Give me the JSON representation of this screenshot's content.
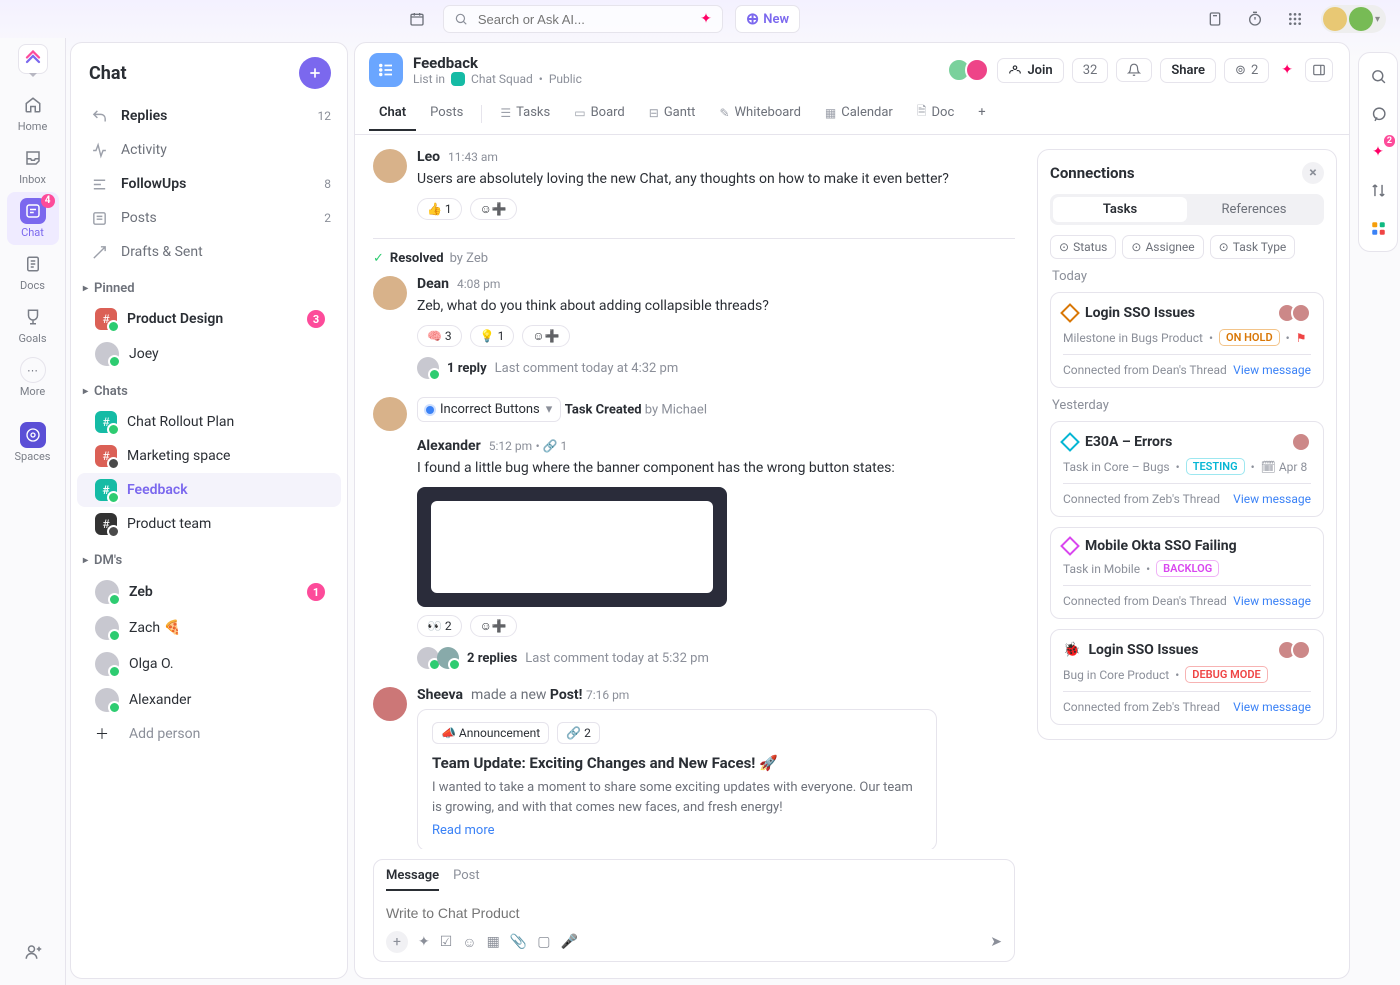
{
  "topbar": {
    "search_placeholder": "Search or Ask AI...",
    "new_label": "New"
  },
  "rail": [
    {
      "key": "home",
      "label": "Home"
    },
    {
      "key": "inbox",
      "label": "Inbox"
    },
    {
      "key": "chat",
      "label": "Chat",
      "active": true,
      "badge": "4"
    },
    {
      "key": "docs",
      "label": "Docs"
    },
    {
      "key": "goals",
      "label": "Goals"
    },
    {
      "key": "more",
      "label": "More"
    },
    {
      "key": "spaces",
      "label": "Spaces"
    }
  ],
  "sidebar": {
    "title": "Chat",
    "top": [
      {
        "label": "Replies",
        "count": "12",
        "bold": true,
        "icon": "reply-icon"
      },
      {
        "label": "Activity",
        "icon": "activity-icon"
      },
      {
        "label": "FollowUps",
        "count": "8",
        "bold": true,
        "icon": "followups-icon"
      },
      {
        "label": "Posts",
        "count": "2",
        "icon": "posts-icon"
      },
      {
        "label": "Drafts & Sent",
        "icon": "drafts-icon"
      }
    ],
    "pinned_label": "Pinned",
    "pinned": [
      {
        "label": "Product Design",
        "badge": "3",
        "bold": true,
        "off": false,
        "color": "#db6056"
      },
      {
        "label": "Joey",
        "avatar": true
      }
    ],
    "chats_label": "Chats",
    "chats": [
      {
        "label": "Chat Rollout Plan",
        "color": "#15bba5"
      },
      {
        "label": "Marketing space",
        "color": "#db6056",
        "off": true
      },
      {
        "label": "Feedback",
        "color": "#15bba5",
        "selected": true
      },
      {
        "label": "Product team",
        "off": true,
        "color": "#333"
      }
    ],
    "dms_label": "DM's",
    "dms": [
      {
        "label": "Zeb",
        "badge": "1",
        "bold": true
      },
      {
        "label": "Zach",
        "emoji": "🍕"
      },
      {
        "label": "Olga O."
      },
      {
        "label": "Alexander"
      }
    ],
    "add_person": "Add person"
  },
  "breadcrumb": {
    "title": "Feedback",
    "subtitle_prefix": "List in",
    "space": "Chat Squad",
    "visibility": "Public"
  },
  "header_actions": {
    "join": "Join",
    "count": "32",
    "share": "Share",
    "viewers": "2"
  },
  "tabs": [
    "Chat",
    "Posts",
    "Tasks",
    "Board",
    "Gantt",
    "Whiteboard",
    "Calendar",
    "Doc"
  ],
  "active_tab": "Chat",
  "resolved": {
    "label": "Resolved",
    "by": "by Zeb"
  },
  "messages": [
    {
      "author": "Leo",
      "time": "11:43 am",
      "text": "Users are absolutely loving the new Chat, any thoughts on how to make it even better?",
      "reactions": [
        {
          "emoji": "👍",
          "count": "1"
        }
      ]
    },
    {
      "author": "Dean",
      "time": "4:08 pm",
      "text": "Zeb, what do you think about adding collapsible threads?",
      "reactions": [
        {
          "emoji": "🧠",
          "count": "3"
        },
        {
          "emoji": "💡",
          "count": "1"
        }
      ],
      "reply": {
        "count": "1 reply",
        "meta": "Last comment today at 4:32 pm"
      }
    },
    {
      "task": {
        "name": "Incorrect Buttons",
        "action": "Task Created",
        "by": "by Michael"
      },
      "author": "Alexander",
      "time": "5:12 pm",
      "linked": "1",
      "text": "I found a little bug where the banner component has the wrong button states:",
      "image": true,
      "reactions": [
        {
          "emoji": "👀",
          "count": "2"
        }
      ],
      "reply": {
        "count": "2 replies",
        "meta": "Last comment today at 5:32 pm"
      }
    }
  ],
  "post": {
    "author": "Sheeva",
    "verb": "made a new",
    "noun": "Post!",
    "time": "7:16 pm",
    "tag": "Announcement",
    "linked": "2",
    "title": "Team Update: Exciting Changes and New Faces! 🚀",
    "body": "I wanted to take a moment to share some exciting updates with everyone. Our team is growing, and with that comes new faces, and fresh energy!",
    "read_more": "Read more"
  },
  "composer": {
    "tabs": [
      "Message",
      "Post"
    ],
    "active": "Message",
    "placeholder": "Write to Chat Product"
  },
  "connections": {
    "title": "Connections",
    "segments": [
      "Tasks",
      "References"
    ],
    "active_segment": "Tasks",
    "filters": [
      "Status",
      "Assignee",
      "Task Type"
    ],
    "groups": [
      {
        "label": "Today",
        "items": [
          {
            "icon_color": "#d97706",
            "title": "Login SSO Issues",
            "meta": "Milestone in Bugs Product",
            "status": "ON HOLD",
            "status_class": "st-hold",
            "flag": true,
            "footer": "Connected from Dean's Thread",
            "link": "View message",
            "avatars": 2
          }
        ]
      },
      {
        "label": "Yesterday",
        "items": [
          {
            "icon_color": "#06b6d4",
            "title": "E30A – Errors",
            "meta": "Task in Core – Bugs",
            "status": "TESTING",
            "status_class": "st-test",
            "date": "Apr 8",
            "footer": "Connected from Zeb's Thread",
            "link": "View message",
            "avatars": 1
          },
          {
            "icon_color": "#d946ef",
            "title": "Mobile Okta SSO Failing",
            "meta": "Task in Mobile",
            "status": "BACKLOG",
            "status_class": "st-back",
            "footer": "Connected from Dean's Thread",
            "link": "View message"
          },
          {
            "icon_color": "#ef4444",
            "title": "Login SSO Issues",
            "bug": true,
            "meta": "Bug in Core Product",
            "status": "DEBUG MODE",
            "status_class": "st-debug",
            "footer": "Connected from Zeb's Thread",
            "link": "View message",
            "avatars": 2
          }
        ]
      }
    ]
  },
  "right_rail_badge": "2"
}
